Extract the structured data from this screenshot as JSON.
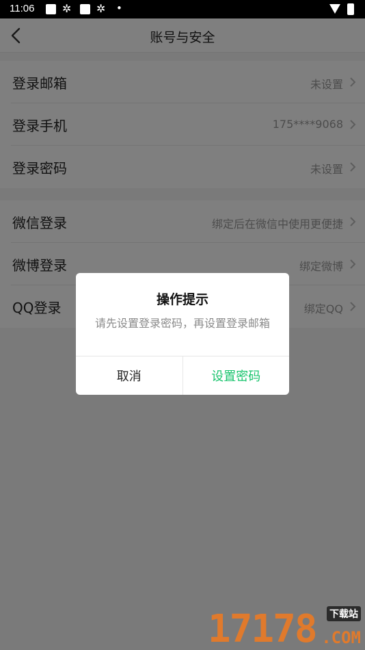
{
  "status_bar": {
    "time": "11:06"
  },
  "nav": {
    "title": "账号与安全"
  },
  "group1": [
    {
      "label": "登录邮箱",
      "value": "未设置"
    },
    {
      "label": "登录手机",
      "value": "175****9068"
    },
    {
      "label": "登录密码",
      "value": "未设置"
    }
  ],
  "group2": [
    {
      "label": "微信登录",
      "value": "绑定后在微信中使用更便捷"
    },
    {
      "label": "微博登录",
      "value": "绑定微博"
    },
    {
      "label": "QQ登录",
      "value": "绑定QQ"
    }
  ],
  "dialog": {
    "title": "操作提示",
    "message": "请先设置登录密码，再设置登录邮箱",
    "cancel_label": "取消",
    "confirm_label": "设置密码"
  },
  "watermark": {
    "digits": "17178",
    "tag": "下载站",
    "domain": ".COM"
  },
  "colors": {
    "accent": "#19c46d",
    "overlay": "rgba(0,0,0,0.5)"
  }
}
